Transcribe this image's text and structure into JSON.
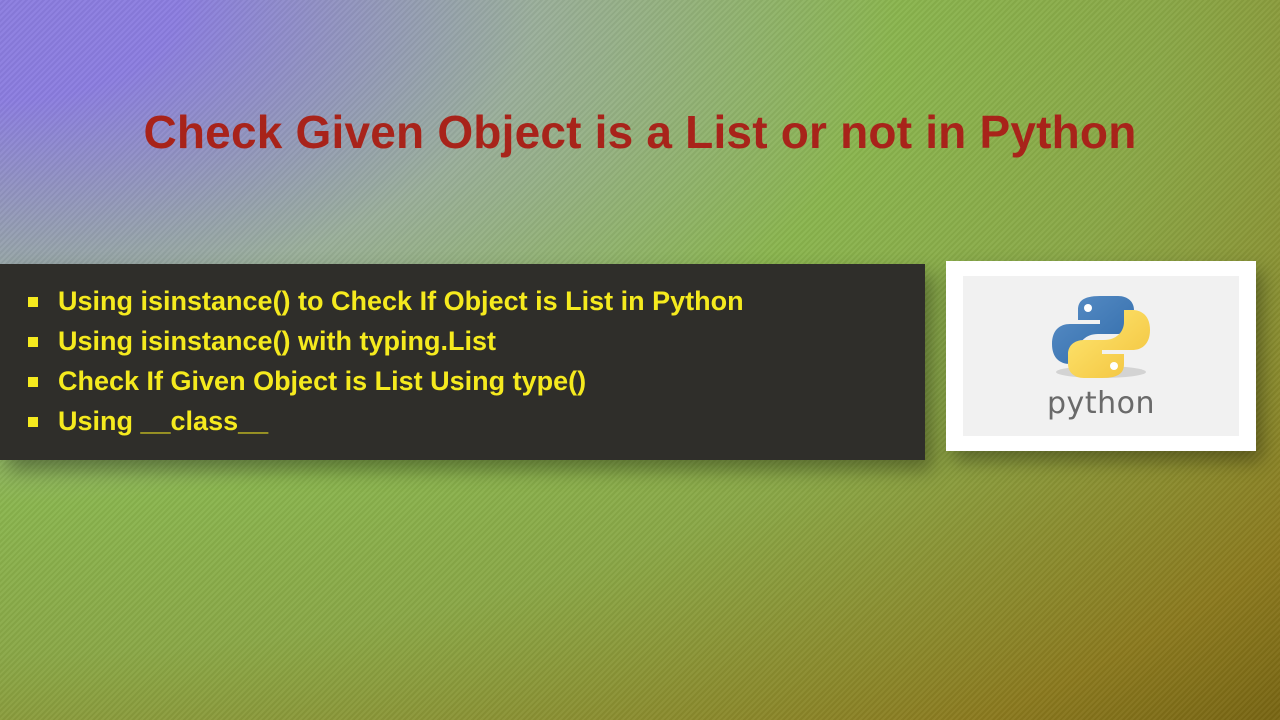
{
  "title": "Check Given Object is a List or not in Python",
  "bullets": [
    "Using isinstance() to Check If Object is List in Python",
    "Using isinstance() with typing.List",
    "Check If Given Object is List Using type()",
    "Using __class__"
  ],
  "logo": {
    "caption": "python"
  }
}
